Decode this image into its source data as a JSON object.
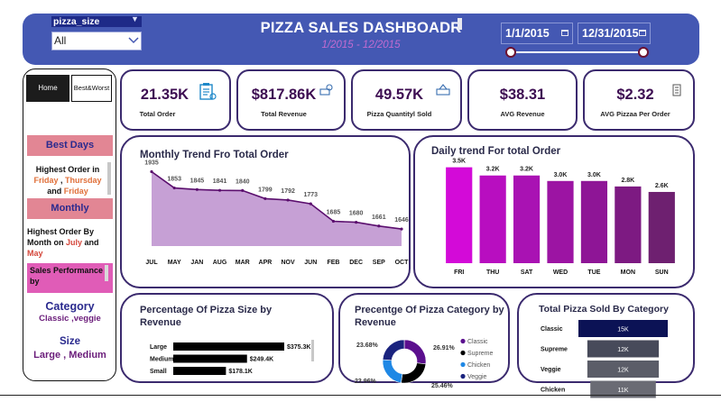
{
  "header": {
    "slicer_label": "pizza_size",
    "slicer_value": "All",
    "title": "PIZZA SALES DASHBOADR",
    "subtitle": "1/2015 - 12/2015",
    "date_start": "1/1/2015",
    "date_end": "12/31/2015",
    "colors": {
      "bar": "#4458b3",
      "slicer_label_bg": "#1e2a88",
      "subtitle": "#c26bd0"
    }
  },
  "sidebar": {
    "home_label": "Home",
    "best_worst_label": "Best&Worst",
    "best_days_head": "Best Days",
    "best_days_line1": "Highest Order in",
    "best_days_d1": "Friday",
    "best_days_sep1": " , ",
    "best_days_d2": "Thursday",
    "best_days_and": "and ",
    "best_days_d3": "Friday",
    "monthly_head": "Monthly",
    "monthly_line": "Highest Order By Month on ",
    "monthly_m1": "July",
    "monthly_and": " and ",
    "monthly_m2": "May",
    "perf_text": "Sales Performance by",
    "category_title": "Category",
    "category_value": "Classic ,veggie",
    "size_title": "Size",
    "size_value": "Large , Medium"
  },
  "kpis": [
    {
      "value": "21.35K",
      "label": "Total Order",
      "icon": "clipboard-icon"
    },
    {
      "value": "$817.86K",
      "label": "Total Revenue",
      "icon": "money-icon"
    },
    {
      "value": "49.57K",
      "label": "Pizza Quantityl Sold",
      "icon": "pizza-box-icon"
    },
    {
      "value": "$38.31",
      "label": "AVG Revenue",
      "icon": ""
    },
    {
      "value": "$2.32",
      "label": "AVG Pizzaa Per Order",
      "icon": "receipt-icon"
    }
  ],
  "chart_data": [
    {
      "type": "area",
      "title": "Monthly Trend Fro Total Order",
      "categories": [
        "JUL",
        "MAY",
        "JAN",
        "AUG",
        "MAR",
        "APR",
        "NOV",
        "JUN",
        "FEB",
        "DEC",
        "SEP",
        "OCT"
      ],
      "values": [
        1935,
        1853,
        1845,
        1841,
        1840,
        1799,
        1792,
        1773,
        1685,
        1680,
        1661,
        1646
      ],
      "ylim": [
        1560,
        1960
      ],
      "color": "#c39bd3",
      "line_color": "#5b0f6e"
    },
    {
      "type": "bar",
      "title": "Daily trend For total Order",
      "categories": [
        "FRI",
        "THU",
        "SAT",
        "WED",
        "TUE",
        "MON",
        "SUN"
      ],
      "values": [
        3.5,
        3.2,
        3.2,
        3.0,
        3.0,
        2.8,
        2.6
      ],
      "labels": [
        "3.5K",
        "3.2K",
        "3.2K",
        "3.0K",
        "3.0K",
        "2.8K",
        "2.6K"
      ],
      "ylim": [
        0,
        3.75
      ],
      "colors": [
        "#d30ad8",
        "#b80ec0",
        "#a912b3",
        "#9c14a3",
        "#8e1596",
        "#7d1a82",
        "#6e2070"
      ]
    },
    {
      "type": "bar",
      "orientation": "horizontal",
      "title": "Percentage Of Pizza Size by Revenue",
      "categories": [
        "Large",
        "Medium",
        "Small"
      ],
      "values": [
        375.3,
        249.4,
        178.1
      ],
      "labels": [
        "$375.3K",
        "$249.4K",
        "$178.1K"
      ],
      "xlim": [
        0,
        375.3
      ],
      "color": "#000000"
    },
    {
      "type": "pie",
      "title": "Precentge Of Pizza Category by Revenue",
      "categories": [
        "Classic",
        "Supreme",
        "Chicken",
        "Veggie"
      ],
      "values": [
        26.91,
        25.46,
        23.96,
        23.68
      ],
      "labels": [
        "26.91%",
        "25.46%",
        "23.96%",
        "23.68%"
      ],
      "colors": [
        "#5b0f8e",
        "#000000",
        "#1f88e5",
        "#1a237e"
      ],
      "legend": "right"
    },
    {
      "type": "bar",
      "orientation": "horizontal",
      "title": "Total Pizza Sold By Category",
      "categories": [
        "Classic",
        "Supreme",
        "Veggie",
        "Chicken"
      ],
      "values": [
        15,
        12,
        12,
        11
      ],
      "labels": [
        "15K",
        "12K",
        "12K",
        "11K"
      ],
      "xlim": [
        0,
        15
      ],
      "colors": [
        "#0b1255",
        "#474a5a",
        "#5b5d68",
        "#6a6b74"
      ]
    }
  ]
}
